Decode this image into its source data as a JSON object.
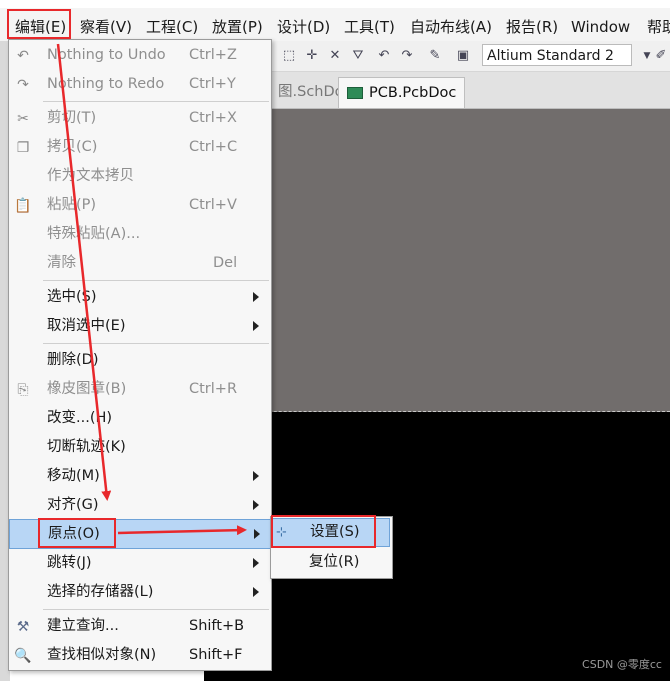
{
  "menubar": {
    "items": [
      {
        "label": "编辑(E)"
      },
      {
        "label": "察看(V)"
      },
      {
        "label": "工程(C)"
      },
      {
        "label": "放置(P)"
      },
      {
        "label": "设计(D)"
      },
      {
        "label": "工具(T)"
      },
      {
        "label": "自动布线(A)"
      },
      {
        "label": "报告(R)"
      },
      {
        "label": "Window"
      },
      {
        "label": "帮助"
      }
    ]
  },
  "toolbar": {
    "standard_select": "Altium Standard 2"
  },
  "tabs": [
    {
      "label": "图.SchDoc"
    },
    {
      "label": "PCB.PcbDoc"
    }
  ],
  "edit_menu": {
    "items": [
      {
        "label": "Nothing to Undo",
        "shortcut": "Ctrl+Z",
        "icon": "undo-icon"
      },
      {
        "label": "Nothing to Redo",
        "shortcut": "Ctrl+Y",
        "icon": "redo-icon"
      },
      {
        "label": "剪切(T)",
        "shortcut": "Ctrl+X",
        "icon": "scissors-icon"
      },
      {
        "label": "拷贝(C)",
        "shortcut": "Ctrl+C",
        "icon": "copy-icon"
      },
      {
        "label": "作为文本拷贝",
        "shortcut": ""
      },
      {
        "label": "粘贴(P)",
        "shortcut": "Ctrl+V",
        "icon": "paste-icon"
      },
      {
        "label": "特殊粘贴(A)...",
        "shortcut": ""
      },
      {
        "label": "清除",
        "shortcut": "Del"
      },
      {
        "label": "选中(S)"
      },
      {
        "label": "取消选中(E)"
      },
      {
        "label": "删除(D)"
      },
      {
        "label": "橡皮图章(B)",
        "shortcut": "Ctrl+R",
        "icon": "stamp-icon"
      },
      {
        "label": "改变...(H)"
      },
      {
        "label": "切断轨迹(K)"
      },
      {
        "label": "移动(M)"
      },
      {
        "label": "对齐(G)"
      },
      {
        "label": "原点(O)"
      },
      {
        "label": "跳转(J)"
      },
      {
        "label": "选择的存储器(L)"
      },
      {
        "label": "建立查询...",
        "shortcut": "Shift+B",
        "icon": "query-icon"
      },
      {
        "label": "查找相似对象(N)",
        "shortcut": "Shift+F",
        "icon": "find-similar-icon"
      }
    ]
  },
  "origin_submenu": {
    "items": [
      {
        "label": "设置(S)",
        "icon": "origin-set-icon"
      },
      {
        "label": "复位(R)"
      }
    ]
  },
  "watermark": "CSDN @零度cc",
  "colors": {
    "canvas_gray": "#716d6c",
    "canvas_black": "#000000",
    "highlight": "#b8d6f5",
    "annotation_red": "#e8282b"
  }
}
